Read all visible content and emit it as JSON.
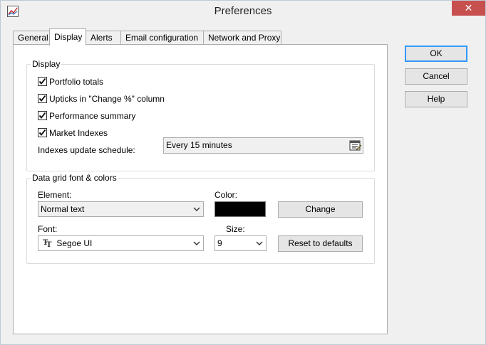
{
  "window": {
    "title": "Preferences",
    "close_glyph": "✕"
  },
  "tabs": [
    {
      "label": "General",
      "active": false
    },
    {
      "label": "Display",
      "active": true
    },
    {
      "label": "Alerts",
      "active": false
    },
    {
      "label": "Email configuration",
      "active": false
    },
    {
      "label": "Network and Proxy",
      "active": false
    }
  ],
  "display_group": {
    "label": "Display",
    "checkboxes": [
      {
        "label": "Portfolio totals",
        "checked": true
      },
      {
        "label": "Upticks in \"Change %\" column",
        "checked": true
      },
      {
        "label": "Performance summary",
        "checked": true
      },
      {
        "label": "Market Indexes",
        "checked": true
      }
    ],
    "schedule_label": "Indexes update schedule:",
    "schedule_value": "Every 15 minutes"
  },
  "grid_group": {
    "label": "Data grid font & colors",
    "element_label": "Element:",
    "element_value": "Normal text",
    "color_label": "Color:",
    "color_value": "#000000",
    "change_button": "Change",
    "font_label": "Font:",
    "font_value": "Segoe UI",
    "size_label": "Size:",
    "size_value": "9",
    "reset_button": "Reset to defaults"
  },
  "buttons": {
    "ok": "OK",
    "cancel": "Cancel",
    "help": "Help"
  },
  "colors": {
    "close_button": "#c7504f",
    "default_button_border": "#3399ff"
  }
}
